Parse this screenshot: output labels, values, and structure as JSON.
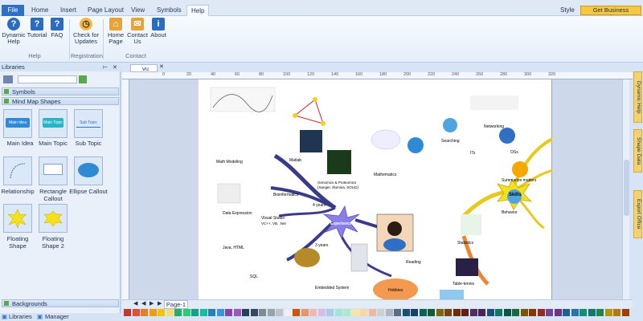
{
  "menubar": {
    "file": "File",
    "tabs": [
      "Home",
      "Insert",
      "Page Layout",
      "View",
      "Symbols",
      "Help"
    ],
    "active_tab": "Help",
    "style_label": "Style",
    "get_business": "Get Business Version..."
  },
  "ribbon": {
    "buttons": [
      {
        "label": "Dynamic Help",
        "icon": "help-icon"
      },
      {
        "label": "Tutorial",
        "icon": "book-icon"
      },
      {
        "label": "FAQ",
        "icon": "faq-icon"
      },
      {
        "label": "Check for Updates",
        "icon": "clock-icon"
      },
      {
        "label": "Home Page",
        "icon": "house-icon"
      },
      {
        "label": "Contact Us",
        "icon": "contact-icon"
      },
      {
        "label": "About",
        "icon": "info-icon"
      }
    ],
    "groups": [
      "Help",
      "Registration",
      "Contact"
    ]
  },
  "left_panel": {
    "title": "Libraries",
    "sections": [
      "Symbols",
      "Mind Map Shapes"
    ],
    "shapes": [
      {
        "label": "Main Idea",
        "inner": "Main Idea"
      },
      {
        "label": "Main Topic",
        "inner": "Main Topic"
      },
      {
        "label": "Sub Topic",
        "inner": "Sub Topic"
      },
      {
        "label": "Relationship",
        "inner": ""
      },
      {
        "label": "Rectangle Callout",
        "inner": ""
      },
      {
        "label": "Ellipse Callout",
        "inner": ""
      },
      {
        "label": "Floating Shape",
        "inner": ""
      },
      {
        "label": "Floating Shape 2",
        "inner": ""
      }
    ],
    "backgrounds_section": "Backgrounds"
  },
  "status": {
    "libraries": "Libraries",
    "manager": "Manager"
  },
  "document": {
    "tab": "vu",
    "page_tab": "Page-1"
  },
  "ruler_h": [
    "0",
    "20",
    "40",
    "60",
    "80",
    "100",
    "120",
    "140",
    "160",
    "180",
    "200",
    "220",
    "240",
    "260",
    "280",
    "300",
    "320"
  ],
  "right_tabs": [
    "Dynamic Help",
    "Shape Data",
    "Export Office"
  ],
  "mindmap": {
    "center": "Experiences",
    "skills": "Skills",
    "labels": [
      "Math Modeling",
      "Matlab",
      "Bioinformatics",
      "Genomics & Proteomics",
      "(Sanger, Illumina, SOLiD)",
      "Data Expression",
      "Visual Studio",
      "VC++, VB, .Net",
      "Java, HTML",
      "SQL",
      "Embedded System",
      "Mathematics",
      "Searching",
      "Networking",
      "ITs",
      "OSs",
      "Summarize matters",
      "Behavior",
      "Statistics",
      "Reading",
      "Table-tennis",
      "Hobbies",
      "4 years",
      "3 years"
    ]
  },
  "palette": [
    "#c0392b",
    "#e74c3c",
    "#e67e22",
    "#f39c12",
    "#f1c40f",
    "#f7dc6f",
    "#27ae60",
    "#2ecc71",
    "#16a085",
    "#1abc9c",
    "#2980b9",
    "#3498db",
    "#8e44ad",
    "#9b59b6",
    "#2c3e50",
    "#34495e",
    "#7f8c8d",
    "#95a5a6",
    "#bdc3c7",
    "#ecf0f1",
    "#d35400",
    "#e59866",
    "#f5b7b1",
    "#d7bde2",
    "#a9cce3",
    "#a3e4d7",
    "#abebc6",
    "#f9e79f",
    "#fad7a0",
    "#edbb99",
    "#ccd1d1",
    "#aeb6bf",
    "#5d6d7e",
    "#1b4f72",
    "#154360",
    "#0e6251",
    "#145a32",
    "#7d6608",
    "#784212",
    "#6e2c00",
    "#641e16",
    "#512e5f",
    "#4a235a",
    "#1a5276",
    "#117864",
    "#0b5345",
    "#186a3b",
    "#7e5109",
    "#873600",
    "#922b21",
    "#76448a",
    "#6c3483",
    "#1f618d",
    "#2874a6",
    "#148f77",
    "#117a65",
    "#1e8449",
    "#b7950b",
    "#b9770e",
    "#a04000"
  ]
}
